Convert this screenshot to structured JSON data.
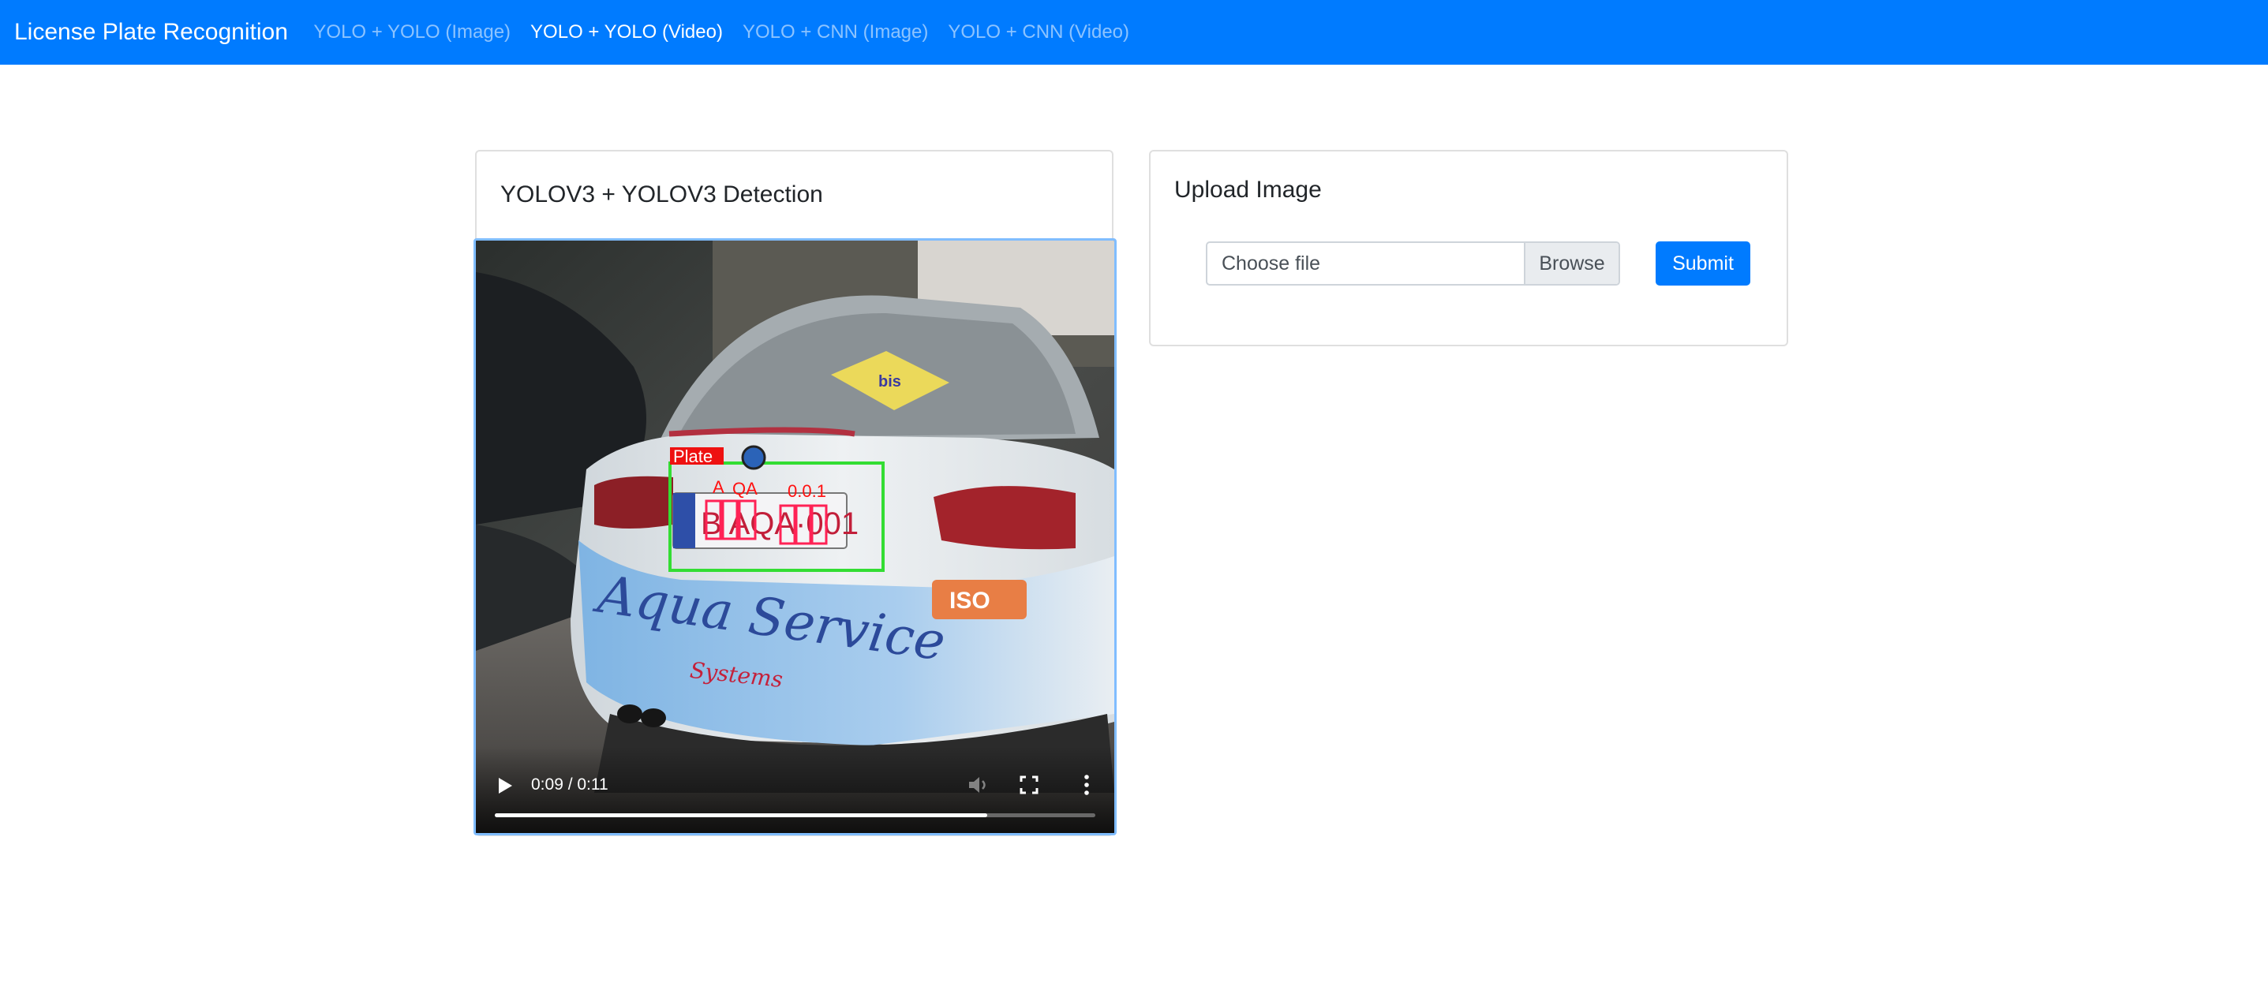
{
  "navbar": {
    "brand": "License Plate Recognition",
    "links": [
      {
        "label": "YOLO + YOLO (Image)",
        "active": false
      },
      {
        "label": "YOLO + YOLO (Video)",
        "active": true
      },
      {
        "label": "YOLO + CNN (Image)",
        "active": false
      },
      {
        "label": "YOLO + CNN (Video)",
        "active": false
      }
    ],
    "color": "#007bff"
  },
  "detection_card": {
    "title": "YOLOV3 + YOLOV3 Detection"
  },
  "video": {
    "time": "0:09 / 0:11",
    "progress_fraction": 0.82,
    "detections": {
      "plate_label": "Plate",
      "char_labels": [
        "A",
        "QA",
        "0.0.1"
      ],
      "sticker_text": "bis",
      "body_text": "Aqua Service",
      "body_subtext": "Systems",
      "badge_text": "ISO",
      "plate_chars": "B AQA·001",
      "box_color": "#33dd33",
      "char_box_color": "#ff2255"
    },
    "icons": [
      "play-icon",
      "volume-icon",
      "fullscreen-icon",
      "more-icon"
    ]
  },
  "upload_card": {
    "title": "Upload Image",
    "file_placeholder": "Choose file",
    "browse_label": "Browse",
    "submit_label": "Submit",
    "accent": "#007bff"
  }
}
